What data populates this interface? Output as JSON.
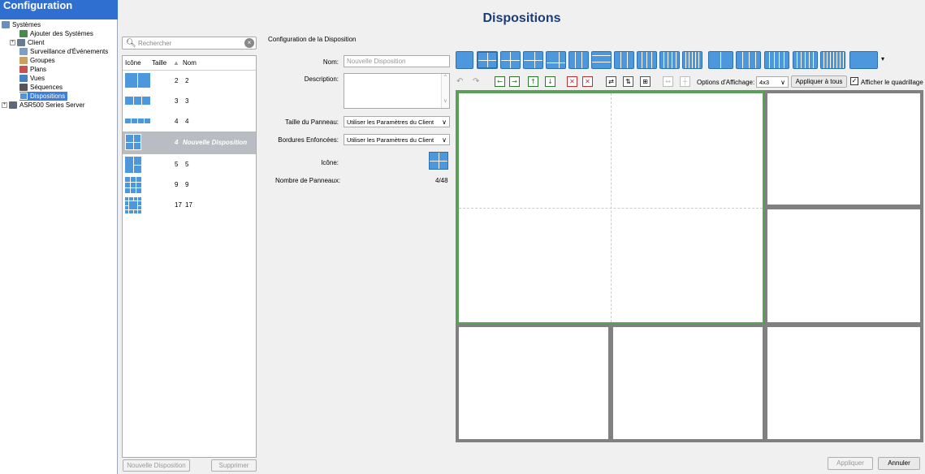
{
  "sidebar": {
    "header": "Configuration",
    "items": [
      {
        "label": "Systèmes",
        "icon": "systems-icon",
        "color": "#6b8fb8"
      },
      {
        "label": "Ajouter des Systèmes",
        "icon": "add-systems-icon",
        "color": "#4a8a4a"
      },
      {
        "label": "Client",
        "icon": "client-icon",
        "color": "#6b7b8c"
      },
      {
        "label": "Surveillance d'Événements",
        "icon": "event-monitor-icon",
        "color": "#7aa0c4"
      },
      {
        "label": "Groupes",
        "icon": "groups-icon",
        "color": "#caa060"
      },
      {
        "label": "Plans",
        "icon": "maps-icon",
        "color": "#c85050"
      },
      {
        "label": "Vues",
        "icon": "views-icon",
        "color": "#4a7fc0"
      },
      {
        "label": "Séquences",
        "icon": "sequences-icon",
        "color": "#555"
      },
      {
        "label": "Dispositions",
        "icon": "layouts-icon",
        "color": "#4d97dc"
      },
      {
        "label": "ASR500 Series Server",
        "icon": "server-icon",
        "color": "#5a6a7a"
      }
    ]
  },
  "page_title": "Dispositions",
  "search": {
    "placeholder": "Rechercher"
  },
  "list": {
    "columns": {
      "icon": "Icône",
      "size": "Taille",
      "name": "Nom"
    },
    "rows": [
      {
        "size": "2",
        "name": "2"
      },
      {
        "size": "3",
        "name": "3"
      },
      {
        "size": "4",
        "name": "4"
      },
      {
        "size": "4",
        "name": "Nouvelle Disposition"
      },
      {
        "size": "5",
        "name": "5"
      },
      {
        "size": "9",
        "name": "9"
      },
      {
        "size": "17",
        "name": "17"
      }
    ]
  },
  "buttons": {
    "new_layout": "Nouvelle Disposition",
    "delete": "Supprimer",
    "apply": "Appliquer",
    "cancel": "Annuler",
    "apply_all": "Appliquer à tous"
  },
  "config": {
    "section_title": "Configuration de la Disposition",
    "name_label": "Nom:",
    "name_placeholder": "Nouvelle Disposition",
    "description_label": "Description:",
    "panel_size_label": "Taille du Panneau:",
    "panel_size_value": "Utiliser les Paramètres du Client",
    "borders_label": "Bordures Enfoncées:",
    "borders_value": "Utiliser les Paramètres du Client",
    "icon_label": "Icône:",
    "panel_count_label": "Nombre de Panneaux:",
    "panel_count_value": "4/48"
  },
  "toolbar": {
    "display_options_label": "Options d'Affichage:",
    "display_options_value": "4x3",
    "show_grid_label": "Afficher le quadrillage",
    "show_grid_checked": true
  },
  "colors": {
    "accent": "#4d97dc",
    "header_bg": "#2f6fcf",
    "selection_border": "#5aa05a"
  }
}
